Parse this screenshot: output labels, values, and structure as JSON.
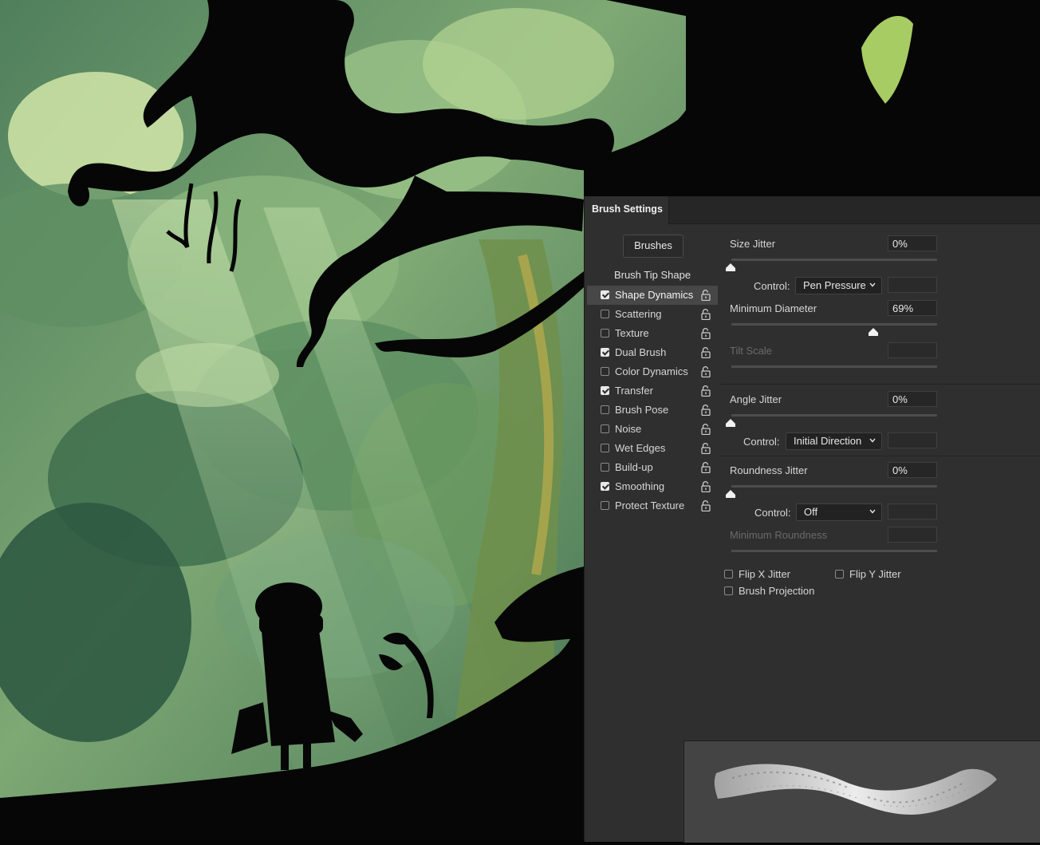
{
  "panel": {
    "tab_title": "Brush Settings",
    "brushes_button": "Brushes",
    "list_header": "Brush Tip Shape",
    "items": [
      {
        "label": "Shape Dynamics",
        "checked": true,
        "active": true
      },
      {
        "label": "Scattering",
        "checked": false,
        "active": false
      },
      {
        "label": "Texture",
        "checked": false,
        "active": false
      },
      {
        "label": "Dual Brush",
        "checked": true,
        "active": false
      },
      {
        "label": "Color Dynamics",
        "checked": false,
        "active": false
      },
      {
        "label": "Transfer",
        "checked": true,
        "active": false
      },
      {
        "label": "Brush Pose",
        "checked": false,
        "active": false
      },
      {
        "label": "Noise",
        "checked": false,
        "active": false
      },
      {
        "label": "Wet Edges",
        "checked": false,
        "active": false
      },
      {
        "label": "Build-up",
        "checked": false,
        "active": false
      },
      {
        "label": "Smoothing",
        "checked": true,
        "active": false
      },
      {
        "label": "Protect Texture",
        "checked": false,
        "active": false
      }
    ]
  },
  "controls": {
    "size_jitter": {
      "label": "Size Jitter",
      "value": "0%",
      "level": 0
    },
    "size_control": {
      "label": "Control:",
      "value": "Pen Pressure"
    },
    "minimum_diameter": {
      "label": "Minimum Diameter",
      "value": "69%",
      "level": 0.69
    },
    "tilt_scale": {
      "label": "Tilt Scale"
    },
    "angle_jitter": {
      "label": "Angle Jitter",
      "value": "0%",
      "level": 0
    },
    "angle_control": {
      "label": "Control:",
      "value": "Initial Direction"
    },
    "roundness_jitter": {
      "label": "Roundness Jitter",
      "value": "0%",
      "level": 0
    },
    "roundness_control": {
      "label": "Control:",
      "value": "Off"
    },
    "minimum_roundness": {
      "label": "Minimum Roundness"
    },
    "flip_x": {
      "label": "Flip X Jitter",
      "checked": false
    },
    "flip_y": {
      "label": "Flip Y Jitter",
      "checked": false
    },
    "projection": {
      "label": "Brush Projection",
      "checked": false
    }
  },
  "icons": {
    "lock": "unlock-icon",
    "dropdown": "chevron-down-icon",
    "slider": "slider-thumb-icon"
  },
  "colors": {
    "panel_bg": "#2f2f2f",
    "canvas_green": "#6f9a6a"
  }
}
